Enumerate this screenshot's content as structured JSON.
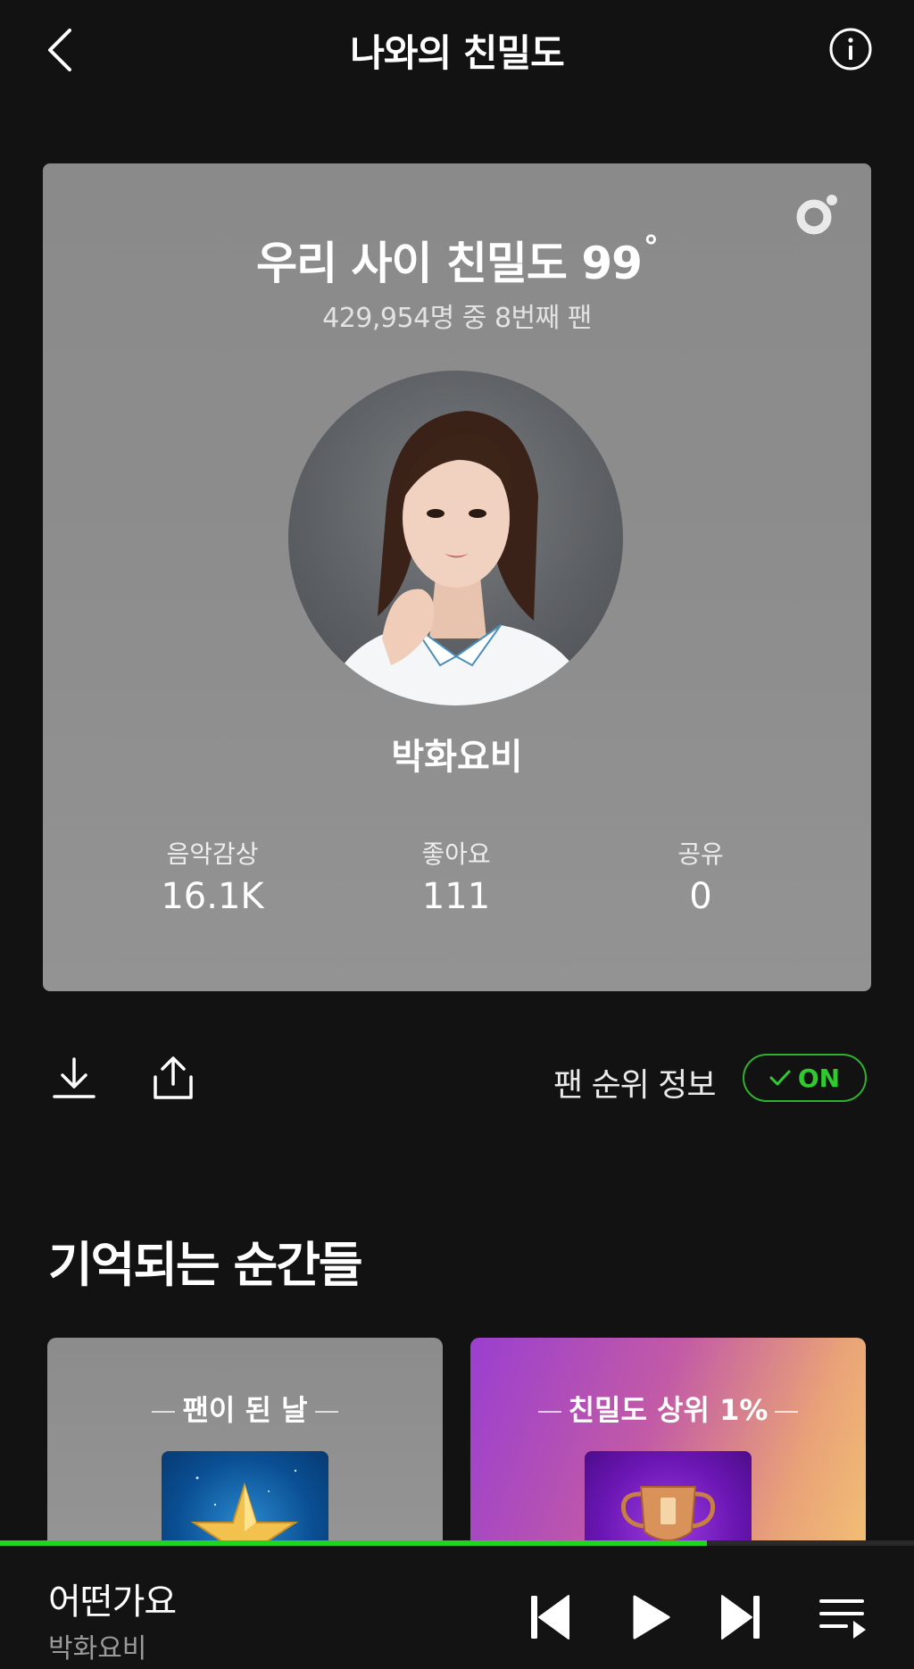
{
  "header": {
    "title": "나와의 친밀도",
    "back_icon": "chevron-left-icon",
    "info_icon": "info-circle-icon"
  },
  "card": {
    "headline": "우리 사이 친밀도 99",
    "degree_symbol": "°",
    "subtitle": "429,954명 중 8번째 팬",
    "artist_name": "박화요비",
    "stats": [
      {
        "label": "음악감상",
        "value": "16.1K"
      },
      {
        "label": "좋아요",
        "value": "111"
      },
      {
        "label": "공유",
        "value": "0"
      }
    ]
  },
  "actions": {
    "download_icon": "download-icon",
    "share_icon": "share-icon",
    "rank_info_label": "팬 순위 정보",
    "toggle_label": "ON",
    "toggle_state": true,
    "accent_color": "#2fca2f"
  },
  "memories": {
    "title": "기억되는 순간들",
    "items": [
      {
        "title": "팬이 된 날",
        "badge_icon": "star-icon"
      },
      {
        "title": "친밀도 상위 1%",
        "badge_icon": "trophy-icon"
      }
    ]
  },
  "player": {
    "song_title": "어떤가요",
    "artist": "박화요비",
    "progress": 0.773,
    "progress_color": "#1ed61e"
  }
}
